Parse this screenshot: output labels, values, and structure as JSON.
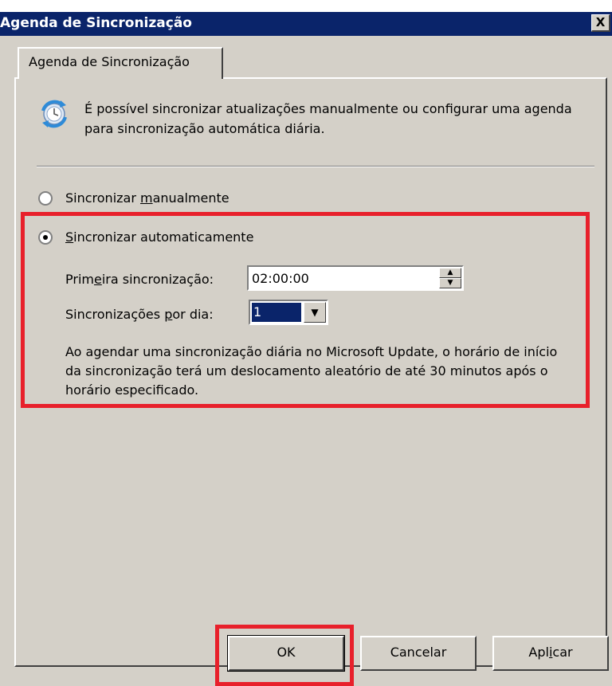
{
  "window": {
    "title": "Agenda de Sincronização",
    "close_label": "X"
  },
  "tabs": [
    {
      "label": "Agenda de Sincronização"
    }
  ],
  "info": {
    "icon": "sync-icon",
    "text": "É possível sincronizar atualizações manualmente ou configurar uma agenda para sincronização automática diária."
  },
  "options": {
    "manual": {
      "label": "Sincronizar manualmente",
      "checked": false
    },
    "auto": {
      "label": "Sincronizar automaticamente",
      "checked": true
    }
  },
  "first_sync": {
    "label": "Primeira sincronização:",
    "value": "02:00:00"
  },
  "per_day": {
    "label": "Sincronizações por dia:",
    "value": "1"
  },
  "note": "Ao agendar uma sincronização diária no Microsoft Update, o horário de início da sincronização terá um deslocamento aleatório de até 30 minutos após o horário especificado.",
  "buttons": {
    "ok": "OK",
    "cancel": "Cancelar",
    "apply": "Aplicar"
  },
  "colors": {
    "title_bar": "#0a246a",
    "highlight": "#e8202b",
    "face": "#d4d0c8"
  }
}
